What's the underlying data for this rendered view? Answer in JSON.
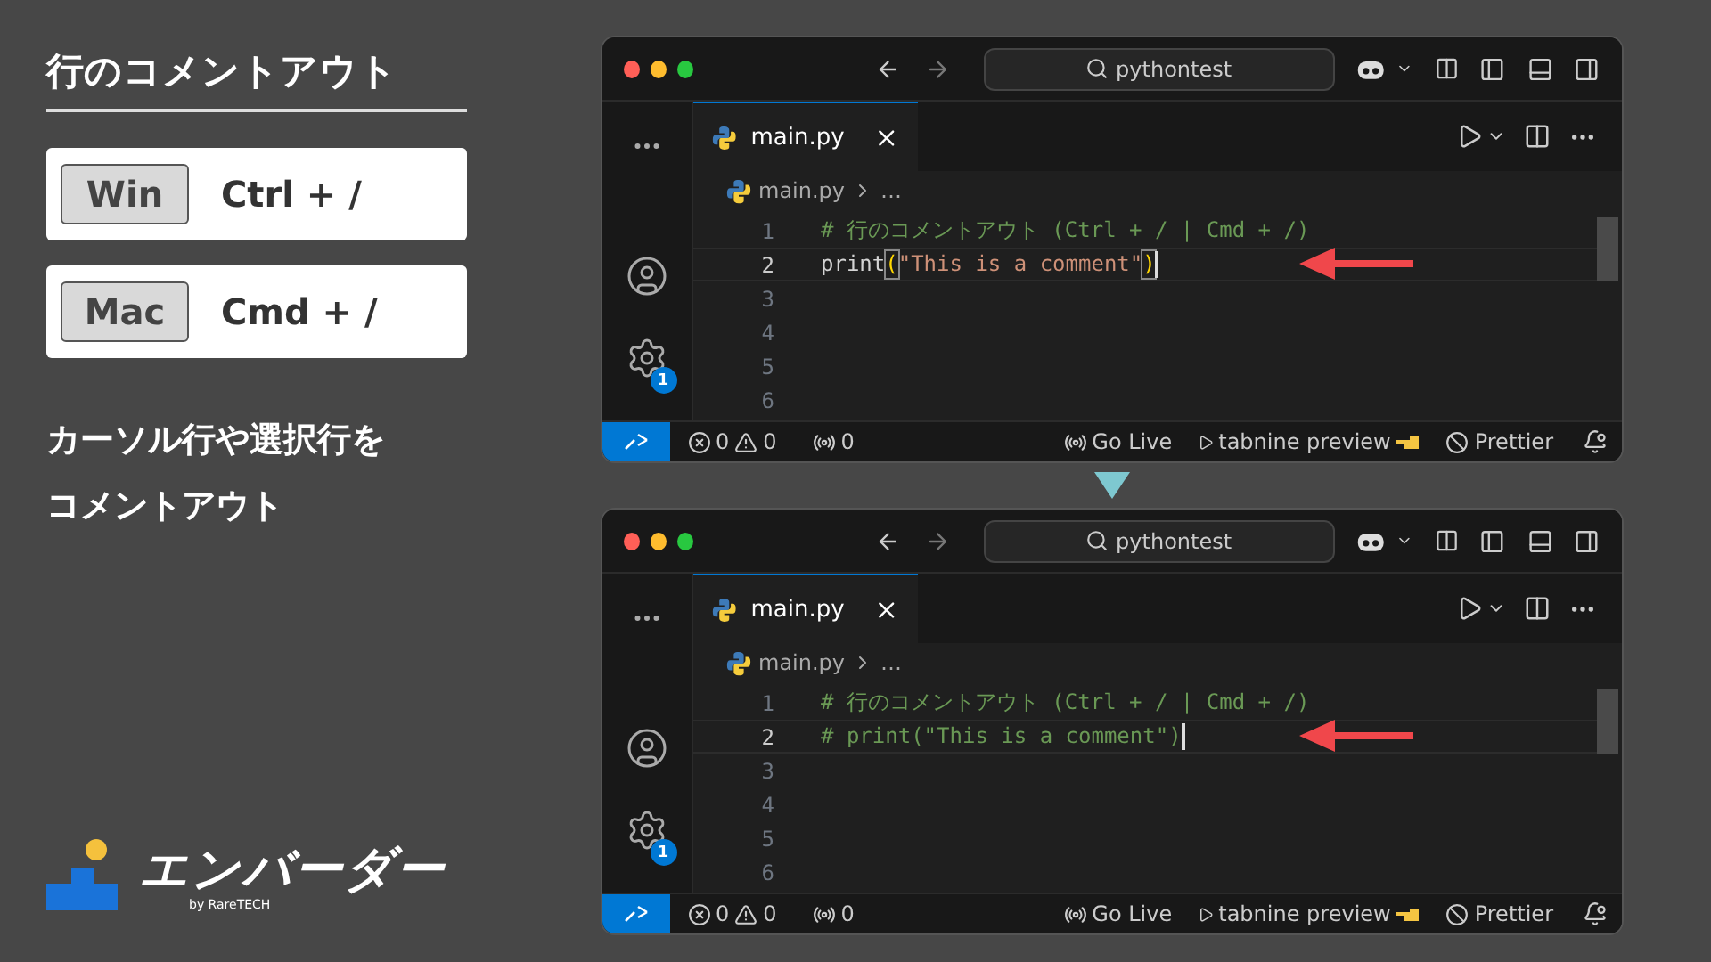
{
  "heading": "行のコメントアウト",
  "shortcuts": [
    {
      "key": "Win",
      "combo": "Ctrl + /"
    },
    {
      "key": "Mac",
      "combo": "Cmd + /"
    }
  ],
  "description": [
    "カーソル行や選択行を",
    "コメントアウト"
  ],
  "logo": {
    "name": "エンバーダー",
    "byline": "by RareTECH"
  },
  "editors": [
    {
      "search": "pythontest",
      "tab": {
        "label": "main.py",
        "selected": true
      },
      "breadcrumb": [
        "main.py",
        "…"
      ],
      "badge": "1",
      "lines": [
        {
          "number": "1",
          "current": false,
          "tokens": [
            {
              "kind": "comment",
              "text": "# 行のコメントアウト (Ctrl + / | Cmd + /)"
            }
          ]
        },
        {
          "number": "2",
          "current": true,
          "tokens": [
            {
              "kind": "plain",
              "text": "print"
            },
            {
              "kind": "bracket",
              "text": "("
            },
            {
              "kind": "string",
              "text": "\"This is a comment\""
            },
            {
              "kind": "bracket",
              "text": ")"
            }
          ]
        },
        {
          "number": "3",
          "current": false
        },
        {
          "number": "4",
          "current": false
        },
        {
          "number": "5",
          "current": false
        },
        {
          "number": "6",
          "current": false
        }
      ],
      "status": {
        "errors": "0",
        "warnings": "0",
        "ports": "0",
        "live": "Go Live",
        "tabnine": "tabnine preview",
        "prettier": "Prettier"
      }
    },
    {
      "search": "pythontest",
      "tab": {
        "label": "main.py",
        "selected": true
      },
      "breadcrumb": [
        "main.py",
        "…"
      ],
      "badge": "1",
      "lines": [
        {
          "number": "1",
          "current": false,
          "tokens": [
            {
              "kind": "comment",
              "text": "# 行のコメントアウト (Ctrl + / | Cmd + /)"
            }
          ]
        },
        {
          "number": "2",
          "current": true,
          "tokens": [
            {
              "kind": "comment",
              "text": "# print(\"This is a comment\")"
            }
          ]
        },
        {
          "number": "3",
          "current": false
        },
        {
          "number": "4",
          "current": false
        },
        {
          "number": "5",
          "current": false
        },
        {
          "number": "6",
          "current": false
        }
      ],
      "status": {
        "errors": "0",
        "warnings": "0",
        "ports": "0",
        "live": "Go Live",
        "tabnine": "tabnine preview",
        "prettier": "Prettier"
      }
    }
  ]
}
